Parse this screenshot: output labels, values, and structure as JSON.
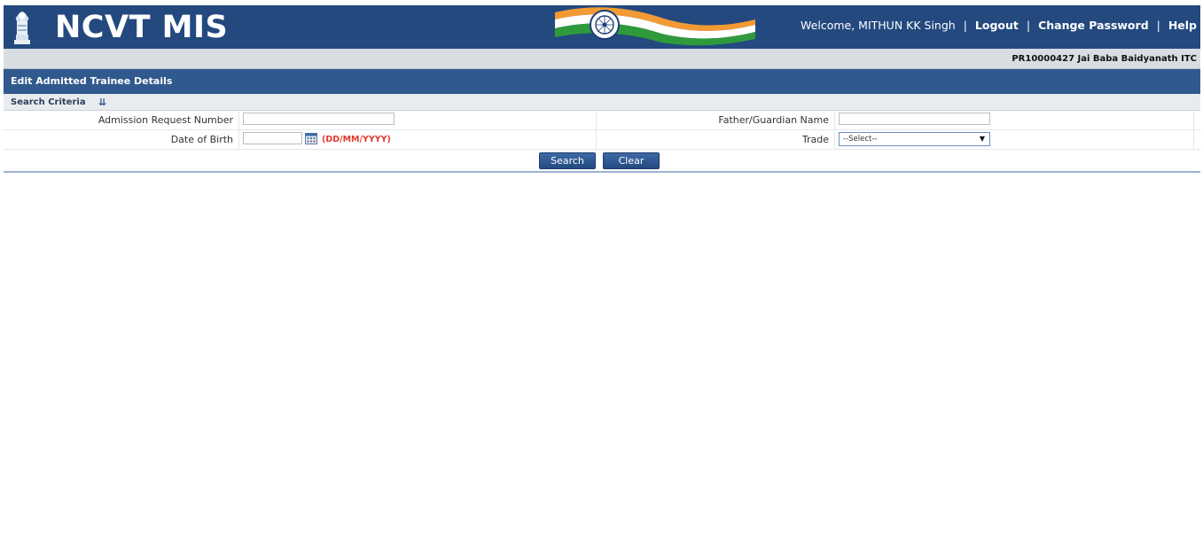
{
  "header": {
    "brand": "NCVT MIS",
    "emblem_icon": "state-emblem-icon",
    "flag_icon": "tricolor-flag-icon",
    "welcome": "Welcome, MITHUN KK Singh",
    "links": {
      "logout": "Logout",
      "change_password": "Change Password",
      "help": "Help"
    },
    "separator": "|"
  },
  "infobar": {
    "institute": "PR10000427 Jai Baba Baidyanath ITC"
  },
  "page": {
    "title": "Edit Admitted Trainee Details",
    "criteria_label": "Search Criteria",
    "criteria_toggle_icon": "double-chevron-down-icon"
  },
  "form": {
    "admission_label": "Admission Request Number",
    "admission_value": "",
    "guardian_label": "Father/Guardian Name",
    "guardian_value": "",
    "dob_label": "Date of Birth",
    "dob_value": "",
    "dob_format": "(DD/MM/YYYY)",
    "trade_label": "Trade",
    "trade_selected": "--Select--"
  },
  "buttons": {
    "search": "Search",
    "clear": "Clear"
  },
  "colors": {
    "header_bg": "#23497f",
    "titlebar_bg": "#30598e",
    "dob_format": "#e03a2e"
  }
}
